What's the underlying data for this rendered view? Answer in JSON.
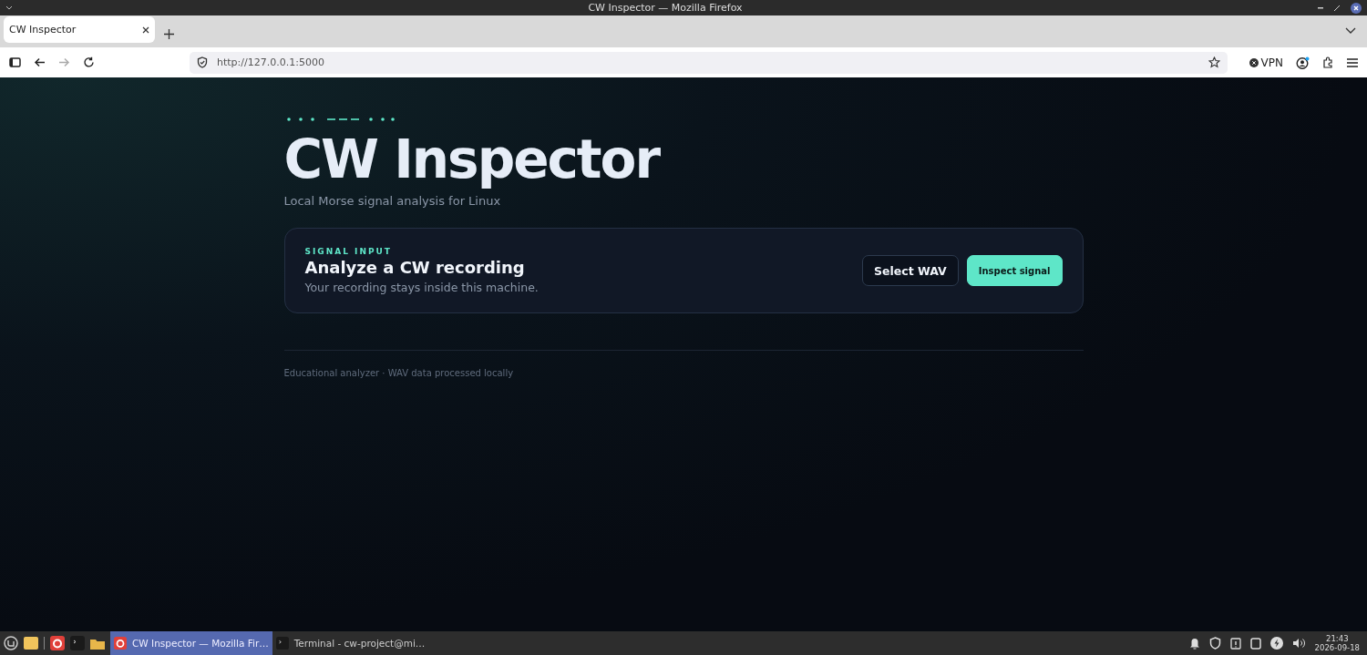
{
  "window": {
    "title": "CW Inspector — Mozilla Firefox"
  },
  "tabs": [
    {
      "label": "CW Inspector",
      "selected": true
    }
  ],
  "address_bar": {
    "url": "http://127.0.0.1:5000"
  },
  "toolbar": {
    "vpn_label": "VPN"
  },
  "page": {
    "title": "CW Inspector",
    "subtitle": "Local Morse signal analysis for Linux",
    "card": {
      "eyebrow": "SIGNAL INPUT",
      "heading": "Analyze a CW recording",
      "note": "Your recording stays inside this machine.",
      "buttons": [
        {
          "label": "Select WAV",
          "kind": "secondary"
        },
        {
          "label": "Inspect signal",
          "kind": "primary"
        }
      ]
    },
    "footer": "Educational analyzer · WAV data processed locally"
  },
  "taskbar": {
    "windows": [
      {
        "label": "CW Inspector — Mozilla Fir…",
        "kind": "browser",
        "selected": true
      },
      {
        "label": "Terminal - cw-project@mi…",
        "kind": "terminal",
        "selected": false
      }
    ],
    "time": "21:43",
    "date": "2026-09-18"
  }
}
